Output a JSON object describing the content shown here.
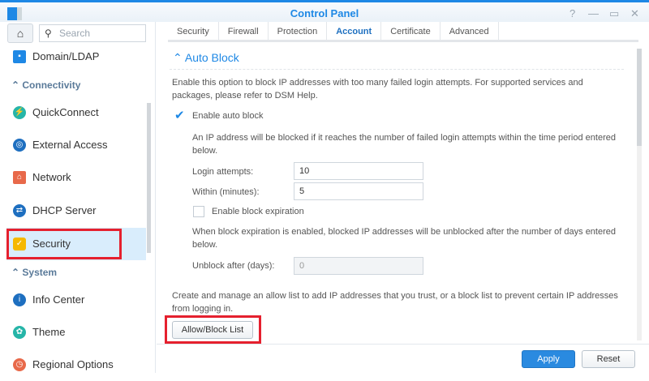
{
  "window": {
    "title": "Control Panel",
    "help": "?",
    "minimize": "—",
    "maximize": "▭",
    "close": "✕"
  },
  "search": {
    "placeholder": "Search"
  },
  "sidebar": {
    "items": [
      {
        "label": "Domain/LDAP"
      },
      {
        "section": "Connectivity"
      },
      {
        "label": "QuickConnect"
      },
      {
        "label": "External Access"
      },
      {
        "label": "Network"
      },
      {
        "label": "DHCP Server"
      },
      {
        "label": "Security"
      },
      {
        "section": "System"
      },
      {
        "label": "Info Center"
      },
      {
        "label": "Theme"
      },
      {
        "label": "Regional Options"
      }
    ]
  },
  "tabs": [
    "Security",
    "Firewall",
    "Protection",
    "Account",
    "Certificate",
    "Advanced"
  ],
  "autoblock": {
    "heading": "Auto Block",
    "desc": "Enable this option to block IP addresses with too many failed login attempts. For supported services and packages, please refer to DSM Help.",
    "enable_label": "Enable auto block",
    "enable_checked": true,
    "sub_desc": "An IP address will be blocked if it reaches the number of failed login attempts within the time period entered below.",
    "login_attempts_label": "Login attempts:",
    "login_attempts": "10",
    "within_label": "Within (minutes):",
    "within": "5",
    "expiration_label": "Enable block expiration",
    "expiration_checked": false,
    "expiration_desc": "When block expiration is enabled, blocked IP addresses will be unblocked after the number of days entered below.",
    "unblock_label": "Unblock after (days):",
    "unblock": "0",
    "list_desc": "Create and manage an allow list to add IP addresses that you trust, or a block list to prevent certain IP addresses from logging in.",
    "list_button": "Allow/Block List"
  },
  "footer": {
    "apply": "Apply",
    "reset": "Reset"
  },
  "colors": {
    "accent": "#1e88e5",
    "highlight": "#e5202e"
  }
}
